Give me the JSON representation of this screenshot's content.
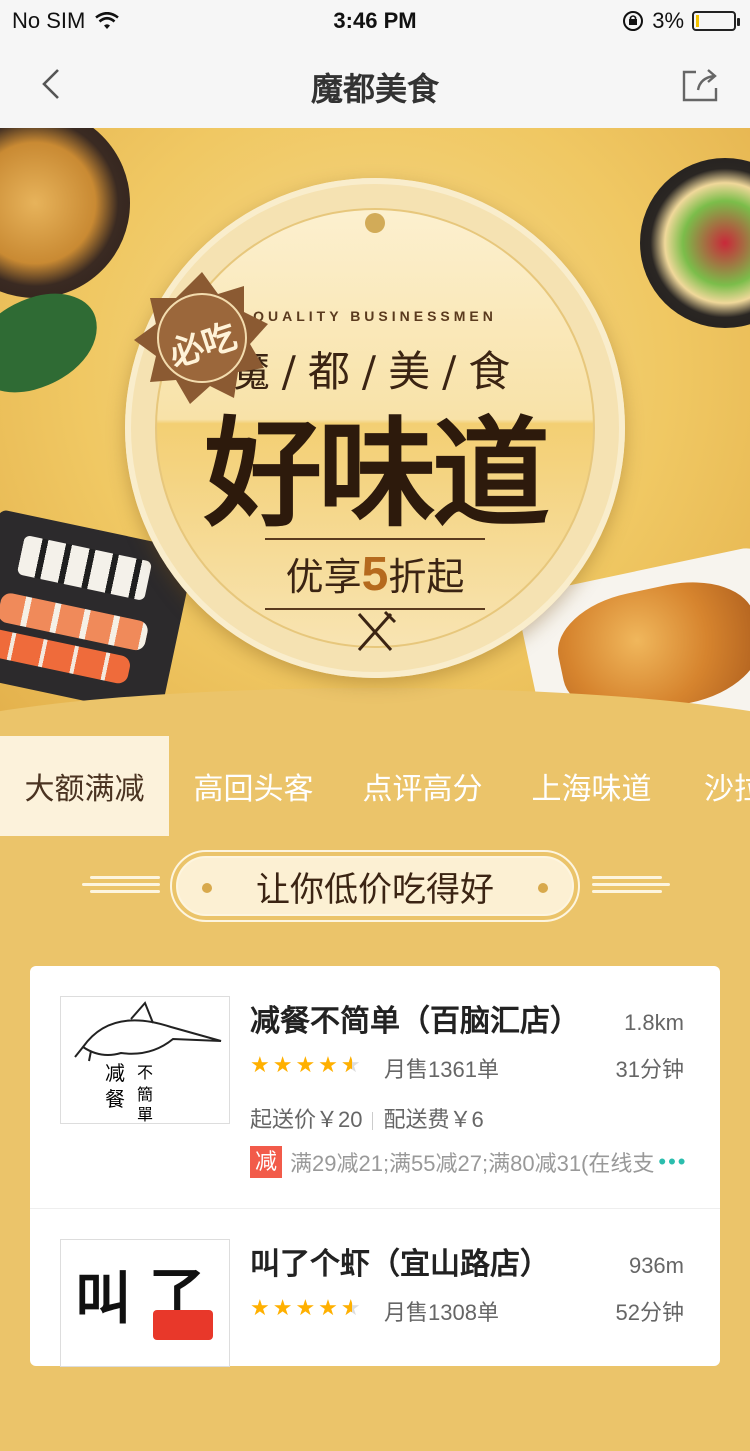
{
  "status_bar": {
    "carrier": "No SIM",
    "time": "3:46 PM",
    "battery": "3%",
    "battery_level": 0.03
  },
  "nav": {
    "title": "魔都美食"
  },
  "banner": {
    "badge": "必吃",
    "tagline": "QUALITY BUSINESSMEN",
    "subtitle": "魔/都/美/食",
    "headline": "好味道",
    "offer_prefix": "优享",
    "offer_number": "5",
    "offer_suffix": "折起"
  },
  "tabs": [
    {
      "label": "大额满减",
      "active": true
    },
    {
      "label": "高回头客",
      "active": false
    },
    {
      "label": "点评高分",
      "active": false
    },
    {
      "label": "上海味道",
      "active": false
    },
    {
      "label": "沙拉",
      "active": false
    }
  ],
  "slogan": "让你低价吃得好",
  "shops": [
    {
      "name": "减餐不简单（百脑汇店）",
      "distance": "1.8km",
      "rating": 4.5,
      "monthly_sales": "月售1361单",
      "delivery_time": "31分钟",
      "min_order": "起送价￥20",
      "delivery_fee": "配送费￥6",
      "promo_tag": "减",
      "promo_text": "满29减21;满55减27;满80减31(在线支",
      "promo_more": "•••",
      "logo_text": [
        "减",
        "不",
        "餐",
        "簡",
        "單"
      ]
    },
    {
      "name": "叫了个虾（宜山路店）",
      "distance": "936m",
      "rating": 4.5,
      "monthly_sales": "月售1308单",
      "delivery_time": "52分钟",
      "logo_text": [
        "叫",
        "了"
      ]
    }
  ],
  "colors": {
    "page_bg": "#ebc46a",
    "accent_red": "#f25b4a",
    "star": "#ffb000",
    "link_teal": "#2bbdad"
  }
}
